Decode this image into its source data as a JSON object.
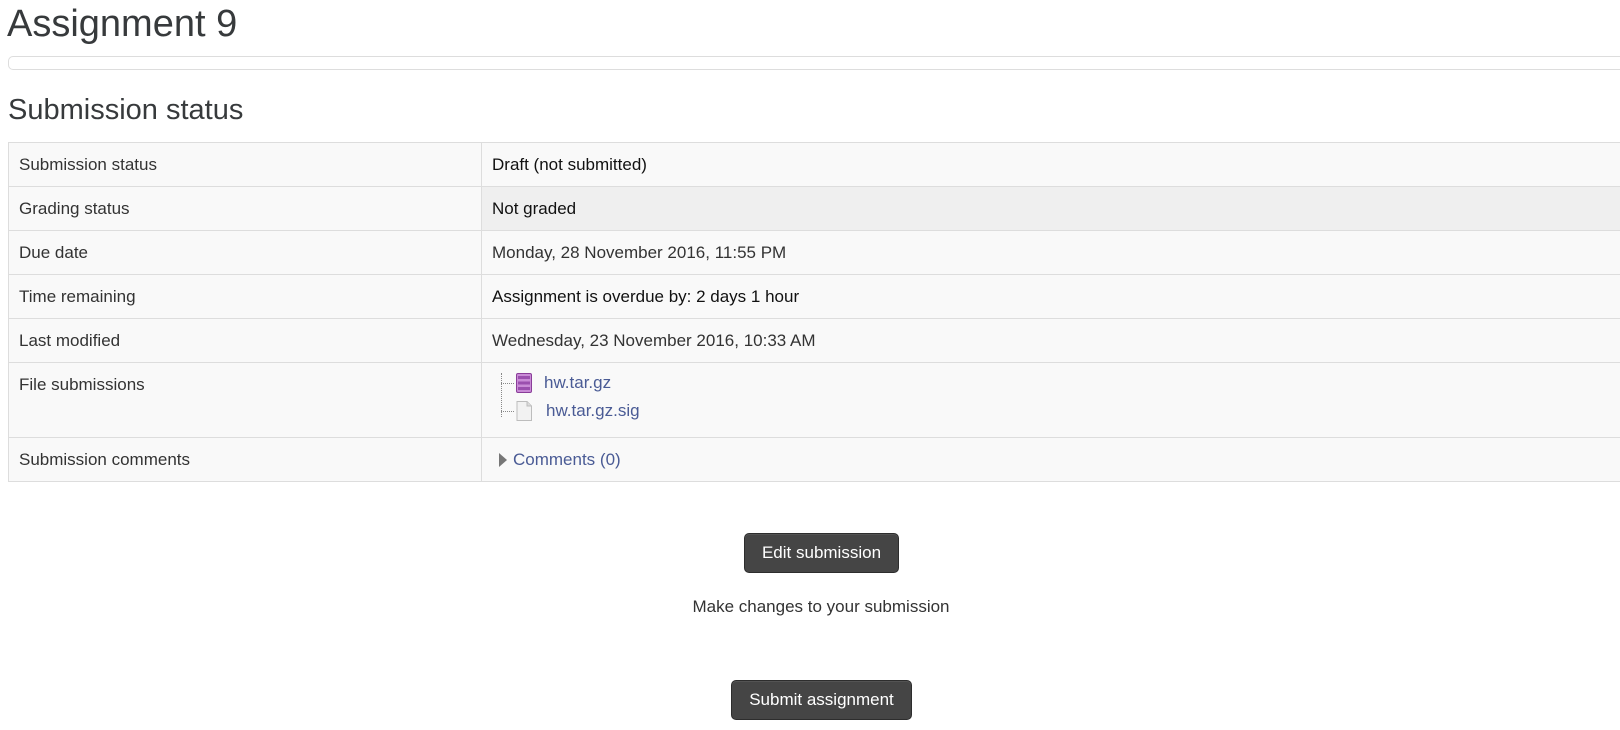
{
  "page_title": "Assignment 9",
  "section_title": "Submission status",
  "rows": [
    {
      "label": "Submission status",
      "value": "Draft (not submitted)"
    },
    {
      "label": "Grading status",
      "value": "Not graded"
    },
    {
      "label": "Due date",
      "value": "Monday, 28 November 2016, 11:55 PM"
    },
    {
      "label": "Time remaining",
      "value": "Assignment is overdue by: 2 days 1 hour"
    },
    {
      "label": "Last modified",
      "value": "Wednesday, 23 November 2016, 10:33 AM"
    },
    {
      "label": "File submissions"
    },
    {
      "label": "Submission comments"
    }
  ],
  "files": [
    {
      "name": "hw.tar.gz",
      "icon": "archive-file-icon"
    },
    {
      "name": "hw.tar.gz.sig",
      "icon": "generic-file-icon"
    }
  ],
  "comments_link": "Comments (0)",
  "buttons": {
    "edit": "Edit submission",
    "edit_help": "Make changes to your submission",
    "submit": "Submit assignment"
  },
  "colors": {
    "overdue_text": "#e8101a",
    "link": "#4a5b95",
    "button_bg": "#454545"
  }
}
